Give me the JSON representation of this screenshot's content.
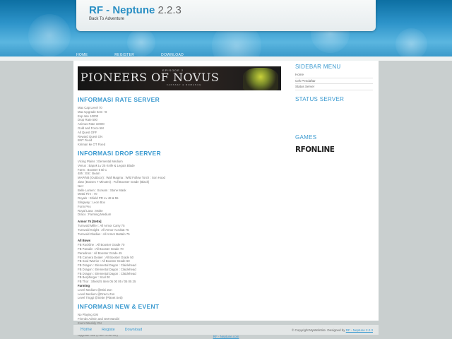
{
  "header": {
    "title": "RF - Neptune",
    "version": "2.2.3",
    "subtitle": "Back To Adventure"
  },
  "nav": [
    "HOME",
    "REGISTER",
    "DOWNLOAD"
  ],
  "banner": {
    "text": "PIONEERS OF NOVUS",
    "episode": "EPISODE 2",
    "tagline": "FANTASY & ROMANCE"
  },
  "rate_section": {
    "title": "INFORMASI RATE SERVER",
    "items": [
      "Max Cap Level 70",
      "Max Upgrade Item +8",
      "Exp rate 10000",
      "Drop Rate 500",
      "Animus Rate 10000",
      "Gold and Force 5M",
      "All Quest OFF",
      "Reward Quest ON",
      "BNT Fixed",
      "Kiriman ke OT Fixed"
    ]
  },
  "drop_section": {
    "title": "INFORMASI DROP SERVER",
    "items": [
      {
        "t": "Vicing Plains : Elemental Medium"
      },
      {
        "t": "Venus : Bapok Lv 25 Knife & Leguts Blade"
      },
      {
        "t": "Farm : Booster 5 Bi C"
      },
      {
        "t": "48h : Elit : Beam"
      },
      {
        "t": "MAP/NB (OutDoor) : Wall Magma : Wild Follow Torch : Son Hood"
      },
      {
        "t": "Jitan (Bosses 7 Minutes) : Full Booster Grade (Black)"
      },
      {
        "t": "Net :"
      },
      {
        "t": "Belle Lumen : Scream : Stone Mask"
      },
      {
        "t": "Metal Fire : 70"
      },
      {
        "t": "Royals : Shield PR Lv 48 & 55"
      },
      {
        "t": "Slingway : Leon Box"
      },
      {
        "t": "Form Pex"
      },
      {
        "t": "Royal Lava : Molte"
      },
      {
        "t": "Draco : Farming Medium"
      },
      {
        "t": "",
        "gap": true
      },
      {
        "t": "Armor 75 [Sette]",
        "bold": true
      },
      {
        "t": "Turnvoid Miller : All Armor Carry 75"
      },
      {
        "t": "Turnvoid Knight : All Armor Acrobat 75"
      },
      {
        "t": "Turnvoid Gladius : All Armor Battalo 75"
      },
      {
        "t": "",
        "gap": true
      },
      {
        "t": "All Bows",
        "bold": true
      },
      {
        "t": "FB Rockline : All Booster Grade 70"
      },
      {
        "t": "FB Paradin : All Booster Grade 70"
      },
      {
        "t": "Paradinos : All Booster Grade 45"
      },
      {
        "t": "FB Camera Dealer : All Booster Grade 50"
      },
      {
        "t": "FB Soul Warrior : All Booster Grade 60"
      },
      {
        "t": "FB Dragon : Elemental Dagon : Claidehead"
      },
      {
        "t": "FB Dragon : Elemental Dagon : Claidehead"
      },
      {
        "t": "FB Dragon : Elemental Dagon : Claidehead"
      },
      {
        "t": "FB Berphinger : Scal 00"
      },
      {
        "t": "FB Thor : Shield 5 Item 05 00 05 / 05 05 25"
      },
      {
        "t": "Farming",
        "bold": true
      },
      {
        "t": "Level Medium @Mini Zon"
      },
      {
        "t": "Level Medium @Draco Zon"
      },
      {
        "t": "Level Tinggi @Sette (Planet Sett)"
      }
    ]
  },
  "news_section": {
    "title": "INFORMASI NEW & EVENT",
    "items": [
      "No Playing GM",
      "Friends Admin and GM Mandiri",
      "Event Weekly ON",
      "Event Kill GM",
      "No Bell Damage (Pure GOM 5m)",
      "Upgrade rate (Pure GOM 5m)"
    ]
  },
  "sidebar": {
    "menu_title": "SIDEBAR MENU",
    "menu_items": [
      "Home",
      "Cek Pendaftar",
      "Status Server"
    ],
    "status_title": "STATUS SERVER",
    "games_title": "GAMES",
    "games_logo": "RFONLINE"
  },
  "footer": {
    "links": [
      "Home",
      "Registe",
      "Download"
    ],
    "copyright": "© Copyright MyWebSite. Designed by",
    "designer": "RF - Neptune 2.2.3"
  },
  "bottom_link": "RF - Neptune.com"
}
